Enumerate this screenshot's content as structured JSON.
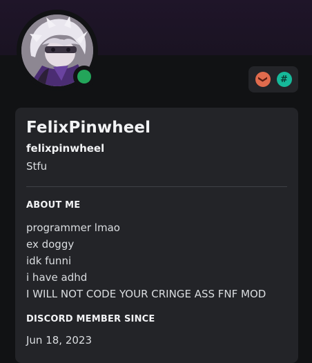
{
  "profile": {
    "display_name": "FelixPinwheel",
    "username": "felixpinwheel",
    "pronouns": "Stfu",
    "status": "online",
    "status_color": "#23a55a",
    "avatar": "anime-character-avatar",
    "badges": [
      {
        "icon": "hypesquad-badge-icon",
        "glyph": "❯",
        "color": "#e06b4d"
      },
      {
        "icon": "hashtag-badge-icon",
        "glyph": "#",
        "color": "#16b99a"
      }
    ]
  },
  "about": {
    "title": "ABOUT ME",
    "lines": [
      "programmer lmao",
      "ex doggy",
      "idk funni",
      "i have adhd",
      "I WILL NOT CODE YOUR CRINGE ASS FNF MOD"
    ]
  },
  "member_since": {
    "title": "DISCORD MEMBER SINCE",
    "date": "Jun 18, 2023"
  },
  "colors": {
    "banner": "#1f1529",
    "card": "#232428",
    "background": "#111214"
  }
}
